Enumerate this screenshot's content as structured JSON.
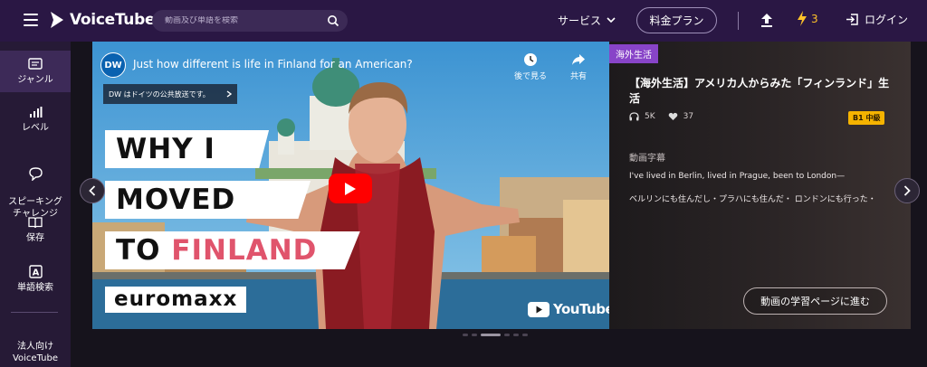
{
  "header": {
    "logo_text": "VoiceTube",
    "search_placeholder": "動画及び単語を検索",
    "services_label": "サービス",
    "plan_label": "料金プラン",
    "energy_count": "3",
    "login_label": "ログイン"
  },
  "sidebar": {
    "items": [
      {
        "label": "ジャンル",
        "icon": "genre-icon"
      },
      {
        "label": "レベル",
        "icon": "level-bars-icon"
      },
      {
        "label": "スピーキング\nチャレンジ",
        "icon": "speech-bubble-icon"
      },
      {
        "label": "保存",
        "icon": "book-icon"
      },
      {
        "label": "単語検索",
        "icon": "dictionary-icon"
      },
      {
        "label": "法人向け\nVoiceTube",
        "icon": ""
      }
    ]
  },
  "video": {
    "yt_title": "Just how different is life in Finland for an American?",
    "channel": "DW",
    "channel_info": "DW はドイツの公共放送です。",
    "watch_later": "後で見る",
    "share": "共有",
    "headline_1": "WHY I",
    "headline_2": "MOVED",
    "headline_3a": "TO ",
    "headline_3b": "FINLAND",
    "brand": "euromaxx",
    "youtube_label": "YouTube",
    "accent_color": "#e0546c"
  },
  "detail": {
    "category": "海外生活",
    "title": "【海外生活】アメリカ人からみた「フィンランド」生活",
    "listens": "5K",
    "likes": "37",
    "level": "B1 中級",
    "subtitle_heading": "動画字幕",
    "subtitle_en": "I've lived in Berlin, lived in Prague, been to London—",
    "subtitle_ja": "ベルリンにも住んだし・プラハにも住んだ・ ロンドンにも行った・",
    "learn_button": "動画の学習ページに進む"
  }
}
